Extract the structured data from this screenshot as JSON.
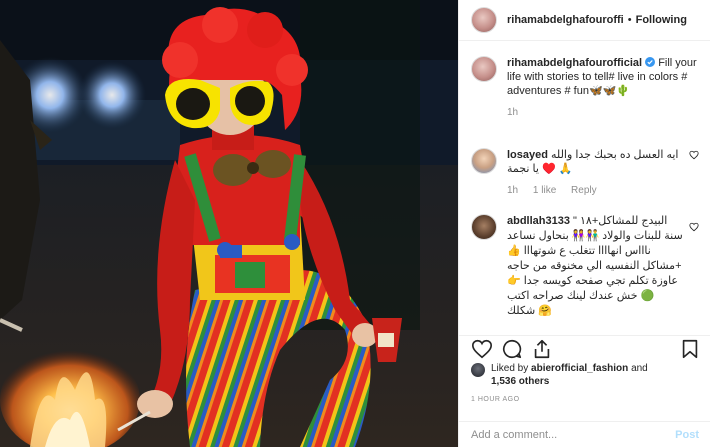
{
  "post": {
    "author": "rihamabdelghafouroffi",
    "follow_status": "Following",
    "separator": "•"
  },
  "caption": {
    "author": "rihamabdelghafourofficial",
    "verified_glyph": "✔",
    "text": "Fill your life with stories to tell# live in colors # adventures # fun🦋🦋🌵",
    "age": "1h"
  },
  "comments": [
    {
      "user": "losayed",
      "text": "ايه العسل ده بحبك جدا والله ♥️ يا نجمة 🙏",
      "age": "1h",
      "likes": "1 like",
      "reply": "Reply"
    },
    {
      "user": "abdllah3133",
      "text": "البيدج للمشاكل+١٨ \" سنة للبنات والولاد 👫👭 بنحاول نساعد ناااس انهاااا تتغلب ع شوتهااا 👍+مشاكل النفسيه الي مخنوقه من حاجه عاوزة تكلم تجي صفحه كويسه جدا 👉🟢 خش عندك لينك صراحه اكتب شكلك 🤗"
    }
  ],
  "likes": {
    "prefix": "Liked by",
    "user": "abierofficial_fashion",
    "joiner": "and",
    "others": "1,536 others"
  },
  "timestamp": "1 HOUR AGO",
  "composer": {
    "placeholder": "Add a comment...",
    "post_label": "Post"
  },
  "colors": {
    "text": "#262626",
    "muted": "#8e8e8e",
    "verified": "#3897f0",
    "post_disabled": "#b2dffc",
    "wig": "#e8211f",
    "sweater": "#d8211c"
  },
  "icons": [
    "heart-icon",
    "comment-icon",
    "share-icon",
    "bookmark-icon",
    "verified-badge-icon"
  ]
}
